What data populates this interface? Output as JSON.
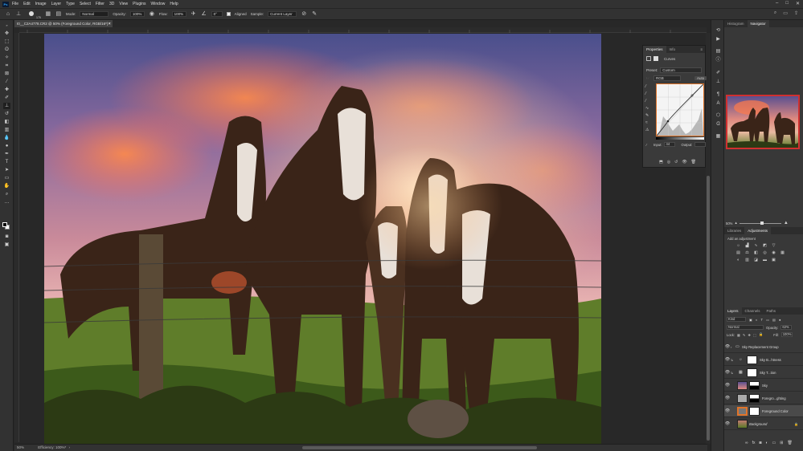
{
  "menu": {
    "items": [
      "File",
      "Edit",
      "Image",
      "Layer",
      "Type",
      "Select",
      "Filter",
      "3D",
      "View",
      "Plugins",
      "Window",
      "Help"
    ]
  },
  "options": {
    "brush_size": "175",
    "mode_label": "Mode:",
    "mode_value": "Normal",
    "opacity_label": "Opacity:",
    "opacity_value": "100%",
    "flow_label": "Flow:",
    "flow_value": "100%",
    "angle_value": "0°",
    "aligned_label": "Aligned",
    "sample_label": "Sample:",
    "sample_value": "Current Layer"
  },
  "document": {
    "tab_title": "I0__C2A4778.CR2 @ 50% (Foreground Color, RGB/16*) *",
    "zoom": "50%",
    "efficiency": "Efficiency: 100%*"
  },
  "properties": {
    "tabs": [
      "Properties",
      "Info"
    ],
    "adjustment": "Curves",
    "preset_label": "Preset:",
    "preset_value": "Custom",
    "channel_value": "RGB",
    "auto_label": "Auto",
    "input_label": "Input:",
    "input_value": "44",
    "output_label": "Output:"
  },
  "nav_panel": {
    "tabs": [
      "Histogram",
      "Navigator"
    ],
    "zoom": "50%"
  },
  "adj_panel": {
    "tabs": [
      "Libraries",
      "Adjustments"
    ],
    "add_label": "Add an adjustment"
  },
  "layers_panel": {
    "tabs": [
      "Layers",
      "Channels",
      "Paths"
    ],
    "filter_kind": "Kind",
    "blend_mode": "Normal",
    "opacity_label": "Opacity:",
    "opacity_value": "62%",
    "lock_label": "Lock:",
    "fill_label": "Fill:",
    "fill_value": "100%",
    "layers": [
      {
        "name": "Sky Replacement Group"
      },
      {
        "name": "Sky B...htness"
      },
      {
        "name": "Sky T...tion"
      },
      {
        "name": "Sky"
      },
      {
        "name": "Foregro...ghting"
      },
      {
        "name": "Foreground Color"
      },
      {
        "name": "Background"
      }
    ]
  }
}
